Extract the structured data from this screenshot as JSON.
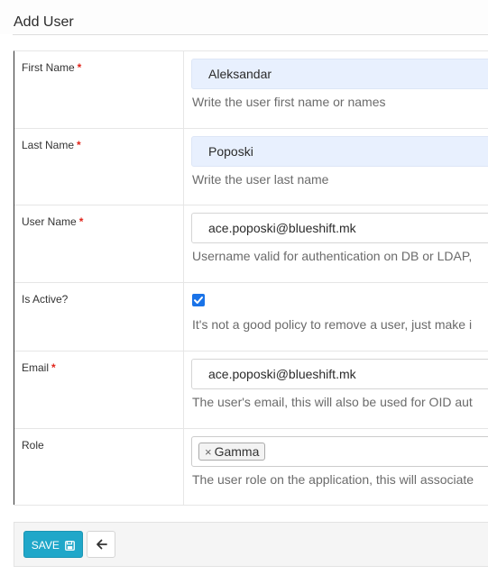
{
  "header": {
    "title": "Add User"
  },
  "form": {
    "first_name": {
      "label": "First Name",
      "required_mark": "*",
      "value": "Aleksandar",
      "help": "Write the user first name or names"
    },
    "last_name": {
      "label": "Last Name",
      "required_mark": "*",
      "value": "Poposki",
      "help": "Write the user last name"
    },
    "user_name": {
      "label": "User Name",
      "required_mark": "*",
      "value": "ace.poposki@blueshift.mk",
      "help": "Username valid for authentication on DB or LDAP,"
    },
    "is_active": {
      "label": "Is Active?",
      "checked": true,
      "help": "It's not a good policy to remove a user, just make i"
    },
    "email": {
      "label": "Email",
      "required_mark": "*",
      "value": "ace.poposki@blueshift.mk",
      "help": "The user's email, this will also be used for OID aut"
    },
    "role": {
      "label": "Role",
      "tag_remove": "×",
      "selected": "Gamma",
      "help": "The user role on the application, this will associate"
    }
  },
  "footer": {
    "save_label": "SAVE",
    "save_icon": "floppy-disk-icon",
    "back_icon": "arrow-left-icon"
  },
  "colors": {
    "primary": "#20a7c9",
    "required": "#e1251b",
    "autofill": "#e8f0fe",
    "checkbox": "#1a73e8"
  }
}
